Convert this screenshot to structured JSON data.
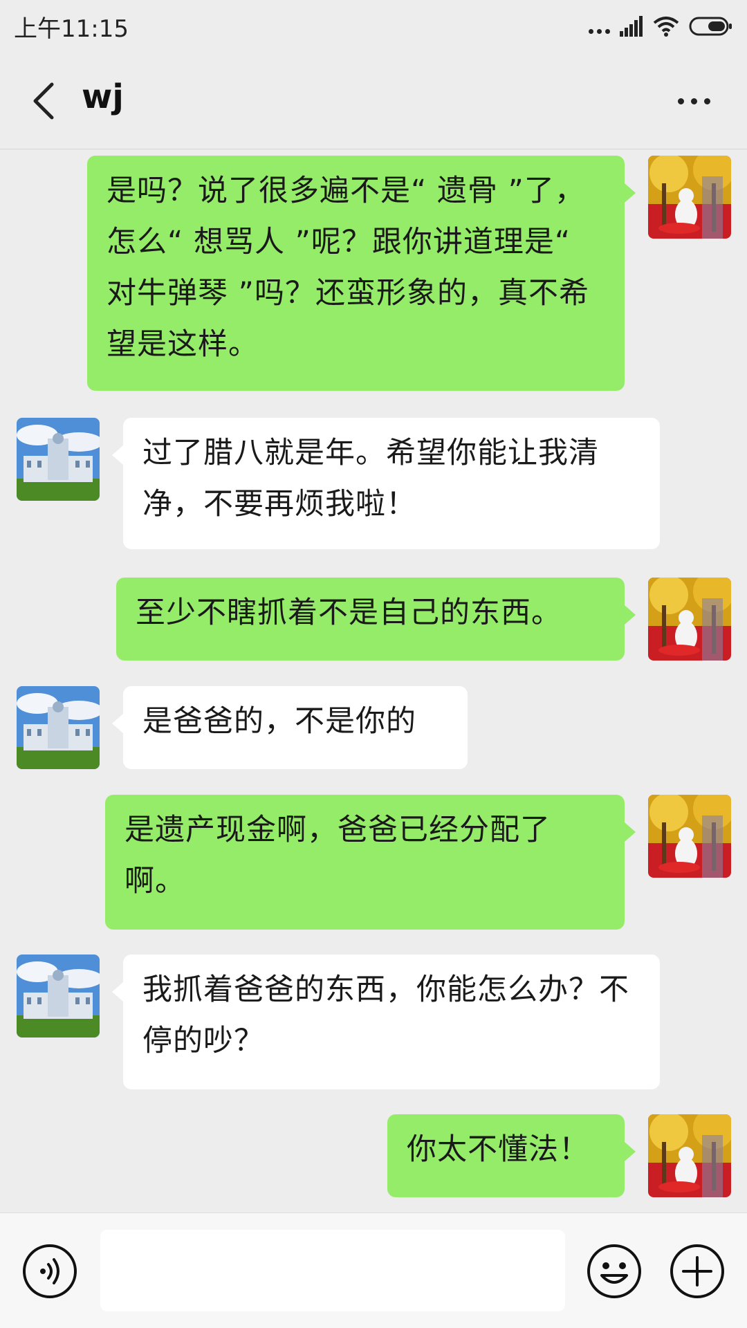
{
  "status_bar": {
    "time": "上午11:15",
    "icons": [
      "dots-icon",
      "signal-icon",
      "wifi-icon",
      "battery-icon"
    ]
  },
  "header": {
    "back_icon": "chevron-left-icon",
    "title": "wj",
    "more_icon": "more-dots-icon"
  },
  "messages": [
    {
      "sender": "me",
      "avatar": "my-avatar-golden-tree",
      "text": "是吗？说了很多遍不是“ 遗骨 ”了，怎么“ 想骂人 ”呢？跟你讲道理是“ 对牛弹琴 ”吗？还蛮形象的，真不希望是这样。"
    },
    {
      "sender": "wj",
      "avatar": "wj-avatar-palace",
      "text": "过了腊八就是年。希望你能让我清净，不要再烦我啦！"
    },
    {
      "sender": "me",
      "avatar": "my-avatar-golden-tree",
      "text": "至少不瞎抓着不是自己的东西。"
    },
    {
      "sender": "wj",
      "avatar": "wj-avatar-palace",
      "text": "是爸爸的，不是你的"
    },
    {
      "sender": "me",
      "avatar": "my-avatar-golden-tree",
      "text": "是遗产现金啊，爸爸已经分配了啊。"
    },
    {
      "sender": "wj",
      "avatar": "wj-avatar-palace",
      "text": "我抓着爸爸的东西，你能怎么办？不停的吵？"
    },
    {
      "sender": "me",
      "avatar": "my-avatar-golden-tree",
      "text": "你太不懂法！"
    }
  ],
  "input_bar": {
    "voice_icon": "voice-icon",
    "input_value": "",
    "emoji_icon": "emoji-icon",
    "plus_icon": "plus-icon"
  },
  "colors": {
    "background": "#ededed",
    "outgoing_bubble": "#95ec69",
    "incoming_bubble": "#ffffff"
  }
}
